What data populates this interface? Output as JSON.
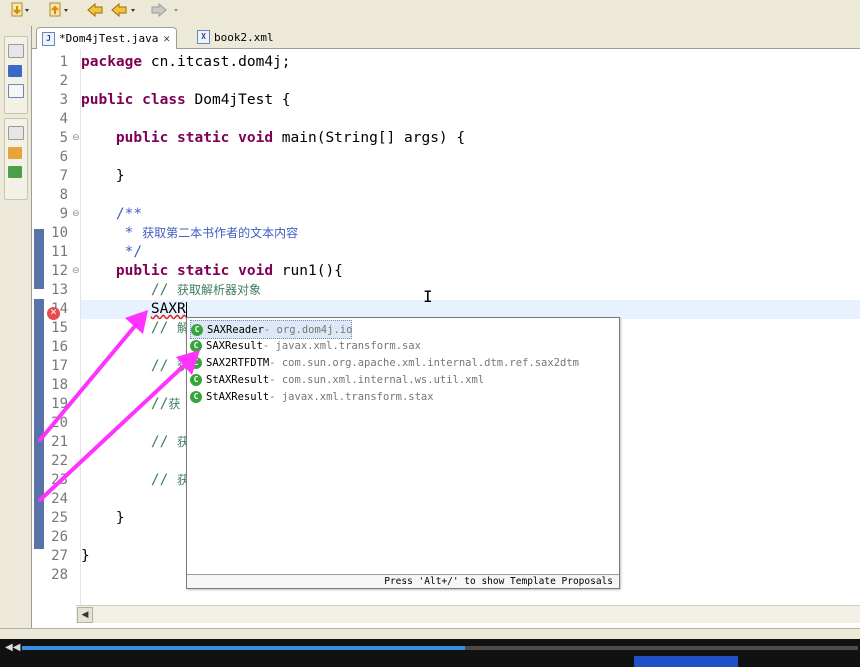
{
  "toolbar": {
    "buttons": [
      "down-arrow-icon",
      "up-arrow-icon",
      "back-icon",
      "forward-icon"
    ]
  },
  "tabs": [
    {
      "label": "*Dom4jTest.java",
      "icon": "J",
      "active": true,
      "close": "✕"
    },
    {
      "label": "book2.xml",
      "icon": "X",
      "active": false
    }
  ],
  "editor": {
    "line_numbers": [
      "1",
      "2",
      "3",
      "4",
      "5",
      "6",
      "7",
      "8",
      "9",
      "10",
      "11",
      "12",
      "13",
      "14",
      "15",
      "16",
      "17",
      "18",
      "19",
      "20",
      "21",
      "22",
      "23",
      "24",
      "25",
      "26",
      "27",
      "28"
    ],
    "code": {
      "l1_kw": "package",
      "l1_rest": " cn.itcast.dom4j;",
      "l3_kw1": "public",
      "l3_kw2": "class",
      "l3_rest": " Dom4jTest {",
      "l5_kw": "public static void",
      "l5_rest": " main(String[] args) {",
      "l7": "    }",
      "l9": "    /**",
      "l10_star": "     * ",
      "l10_text": "获取第二本书作者的文本内容",
      "l11": "     */",
      "l12_kw": "public static void",
      "l12_rest": " run1(){",
      "l13_slash": "        // ",
      "l13_text": "获取解析器对象",
      "l14_typed": "SAXR",
      "l15_slash": "        // ",
      "l15_text": "解",
      "l17_slash": "        // ",
      "l17_text": "获",
      "l19_slash": "        //",
      "l19_text": "获",
      "l21_slash": "        // ",
      "l21_text": "获",
      "l23_slash": "        // ",
      "l23_text": "获",
      "l25": "    }",
      "l27": "}"
    },
    "error_marker": "✕"
  },
  "completion": {
    "items": [
      {
        "name": "SAXReader",
        "qualifier": " - org.dom4j.io",
        "selected": true
      },
      {
        "name": "SAXResult",
        "qualifier": " - javax.xml.transform.sax"
      },
      {
        "name": "SAX2RTFDTM",
        "qualifier": " - com.sun.org.apache.xml.internal.dtm.ref.sax2dtm"
      },
      {
        "name": "StAXResult",
        "qualifier": " - com.sun.xml.internal.ws.util.xml"
      },
      {
        "name": "StAXResult",
        "qualifier": " - javax.xml.transform.stax"
      }
    ],
    "status_text": "Press 'Alt+/' to show Template Proposals",
    "icon_letter": "C"
  },
  "colors": {
    "keyword": "#7f0055",
    "javadoc": "#3f5fbf",
    "comment": "#3f7f5f",
    "annotation_arrow": "#ff33ff",
    "progress": "#3a8fe0"
  },
  "player": {
    "progress_fraction": 0.53
  }
}
